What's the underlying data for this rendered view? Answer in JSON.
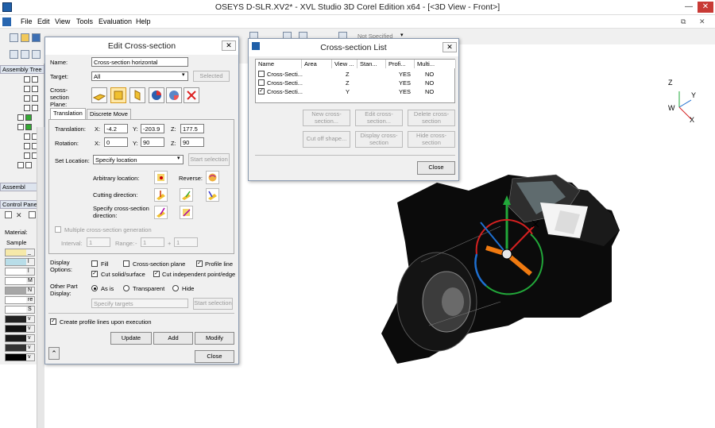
{
  "app": {
    "title": "OSEYS D-SLR.XV2* - XVL Studio 3D Corel Edition x64 - [<3D View - Front>]"
  },
  "menu": [
    "File",
    "Edit",
    "View",
    "Tools",
    "Evaluation",
    "Help"
  ],
  "toolbar": {
    "not_specified": "Not Specified"
  },
  "left_panel": {
    "assembly_tree": "Assembly Tree",
    "assembly_tab": "Assembl",
    "control_panel": "Control Panel",
    "material_label": "Material:",
    "sample_header": "Sample",
    "sample_rows": [
      {
        "color": "#f6e9a9",
        "letter": "_"
      },
      {
        "color": "#b8dde8",
        "letter": "l"
      },
      {
        "color": "#ffffff",
        "letter": "l"
      },
      {
        "color": "#ffffff",
        "letter": "M"
      },
      {
        "color": "#a6a6a6",
        "letter": "N"
      },
      {
        "color": "#ffffff",
        "letter": "re"
      },
      {
        "color": "#ffffff",
        "letter": "S"
      },
      {
        "color": "#222222",
        "letter": "v"
      },
      {
        "color": "#111111",
        "letter": "v"
      },
      {
        "color": "#1a1a1a",
        "letter": "v"
      },
      {
        "color": "#333333",
        "letter": "v"
      },
      {
        "color": "#000000",
        "letter": "v"
      }
    ]
  },
  "edit_dialog": {
    "title": "Edit Cross-section",
    "name_label": "Name:",
    "name_value": "Cross-section horizontal",
    "target_label": "Target:",
    "target_value": "All",
    "selected_button": "Selected",
    "plane_label": "Cross-section Plane:",
    "tabs": [
      "Translation",
      "Discrete Move"
    ],
    "translation_label": "Translation:",
    "rotation_label": "Rotation:",
    "x_label": "X:",
    "y_label": "Y:",
    "z_label": "Z:",
    "translation": {
      "x": "-4.2",
      "y": "-203.9",
      "z": "177.5"
    },
    "rotation": {
      "x": "0",
      "y": "90",
      "z": "90"
    },
    "set_location_label": "Set Location:",
    "set_location_value": "Specify location",
    "start_selection": "Start selection",
    "arbitrary_location": "Arbitrary location:",
    "reverse": "Reverse:",
    "cutting_direction": "Cutting direction:",
    "specify_direction": "Specify cross-section direction:",
    "multiple_generation": "Multiple cross-section generation",
    "interval_label": "Interval:",
    "interval_value": "1",
    "range_label": "Range:",
    "range_minus": "-",
    "range_from": "1",
    "range_plus": "+",
    "range_to": "1",
    "display_options_label": "Display Options:",
    "fill": "Fill",
    "cross_section_plane": "Cross-section plane",
    "profile_line": "Profile line",
    "cut_solid": "Cut solid/surface",
    "cut_independent": "Cut independent point/edge",
    "other_part_label": "Other Part Display:",
    "as_is": "As is",
    "transparent": "Transparent",
    "hide": "Hide",
    "specify_targets": "Specify targets",
    "start_selection2": "Start selection",
    "create_profile": "Create profile lines upon execution",
    "update": "Update",
    "add": "Add",
    "modify": "Modify",
    "close": "Close"
  },
  "list_dialog": {
    "title": "Cross-section List",
    "columns": [
      "Name",
      "Area",
      "View ...",
      "Stan...",
      "Profi...",
      "Multi..."
    ],
    "rows": [
      {
        "name": "Cross-Secti...",
        "area": "",
        "view": "Z",
        "stan": "",
        "profile": "YES",
        "multi": "NO",
        "checked": false
      },
      {
        "name": "Cross-Secti...",
        "area": "",
        "view": "Z",
        "stan": "",
        "profile": "YES",
        "multi": "NO",
        "checked": false
      },
      {
        "name": "Cross-Secti...",
        "area": "",
        "view": "Y",
        "stan": "",
        "profile": "YES",
        "multi": "NO",
        "checked": true
      }
    ],
    "new_btn": "New cross-section...",
    "edit_btn": "Edit cross-section...",
    "delete_btn": "Delete cross-section",
    "cutoff_btn": "Cut off shape...",
    "display_btn": "Display cross-section",
    "hide_btn": "Hide cross-section",
    "close_btn": "Close"
  },
  "axes": {
    "z": "Z",
    "y": "Y",
    "w": "W",
    "x": "X"
  },
  "colors": {
    "accent": "#d69a1e",
    "gizmo_green": "#22a83a",
    "gizmo_red": "#d42020",
    "gizmo_blue": "#1e6fd0",
    "gizmo_orange": "#f07a10"
  }
}
